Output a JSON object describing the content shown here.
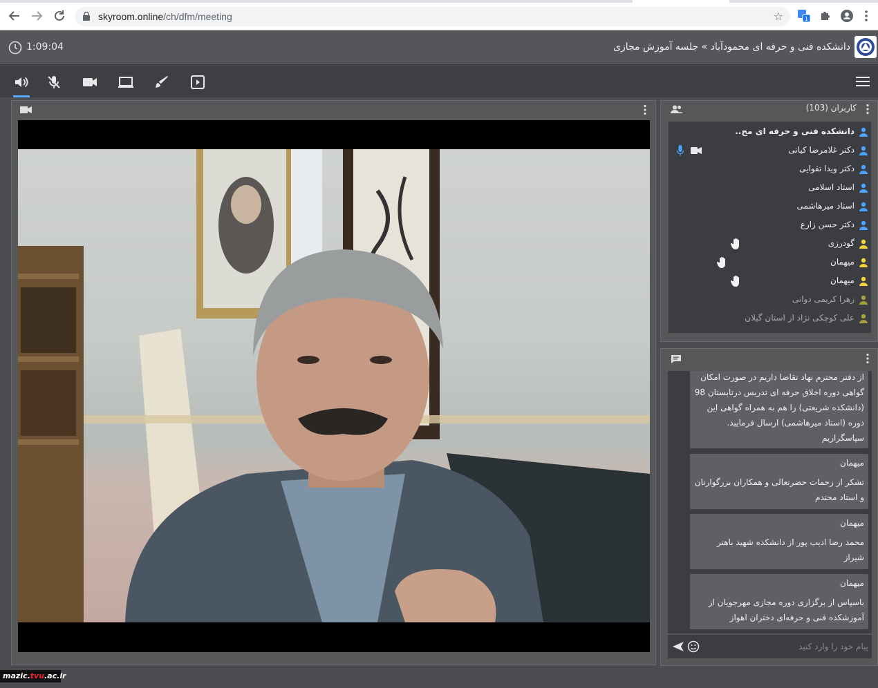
{
  "browser": {
    "url_host": "skyroom.online",
    "url_path": "/ch/dfm/meeting"
  },
  "header": {
    "timer": "1:09:04",
    "title": "دانشکده فنی و حرفه ای محمودآباد » جلسه آموزش مجازی"
  },
  "toolbar": {
    "tools": [
      "speaker-icon",
      "mic-off-icon",
      "camera-icon",
      "screen-share-icon",
      "pen-icon",
      "presentation-icon"
    ],
    "accent": "#5aa8ff"
  },
  "users": {
    "title": "کاربران (103)",
    "list": [
      {
        "name": "دانشکده فنی و حرفه ای مح..",
        "role": "host"
      },
      {
        "name": "دکتر غلامرضا کیانی",
        "role": "presenter"
      },
      {
        "name": "دکتر ویدا تقوایی",
        "role": "presenter"
      },
      {
        "name": "استاد اسلامی",
        "role": "presenter"
      },
      {
        "name": "استاد میرهاشمی",
        "role": "presenter"
      },
      {
        "name": "دکتر حسن زارع",
        "role": "presenter"
      },
      {
        "name": "گودرزی",
        "role": "guest"
      },
      {
        "name": "میهمان",
        "role": "guest"
      },
      {
        "name": "میهمان",
        "role": "guest"
      },
      {
        "name": "زهرا کریمی دوانی",
        "role": "guest"
      },
      {
        "name": "علی کوچکی نژاد از استان گیلان",
        "role": "guest"
      }
    ],
    "colors": {
      "presenter": "#4aa3ff",
      "guest": "#f2d33c",
      "guest_dim": "#a6a03c"
    }
  },
  "chat": {
    "messages": [
      {
        "sender": "",
        "text": "از دفتر محترم نهاد تقاضا داریم در صورت امکان گواهی دوره اخلاق حرفه ای تدریس درتابستان 98 (دانشکده شریعتی) را هم به همراه گواهی این دوره (استاد میرهاشمی) ارسال فرمایید. سپاسگزاریم"
      },
      {
        "sender": "میهمان",
        "text": "تشکر از زحمات حضرتعالی و همکاران بزرگوارتان و استاد محتدم"
      },
      {
        "sender": "میهمان",
        "text": "محمد رضا ادیب پور از دانشکده شهید باهنر شیراز"
      },
      {
        "sender": "میهمان",
        "text": "باسپاس از برگزاری دوره مجازی مهرجویان از آموزشکده فنی و حرفه‌ای دختران اهواز"
      }
    ],
    "input_placeholder": "پیام خود را وارد کنید"
  },
  "watermark": {
    "prefix": "mazic.",
    "accent": "tvu",
    "suffix": ".ac.ir"
  }
}
